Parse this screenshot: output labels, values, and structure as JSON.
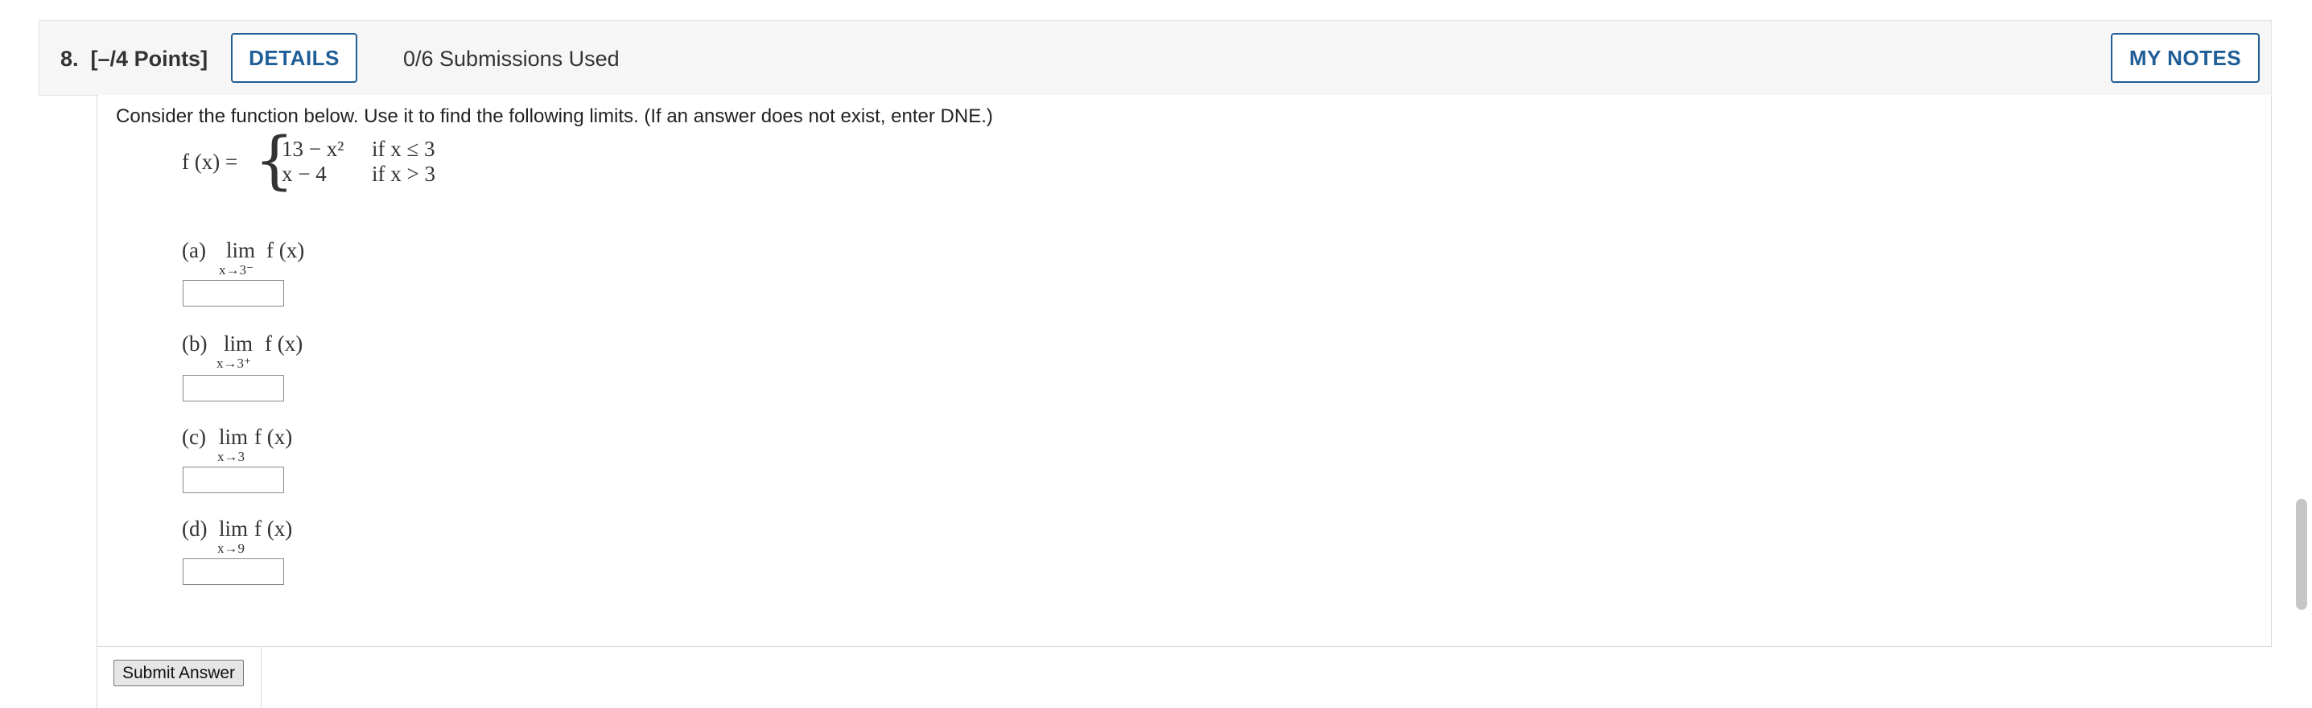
{
  "header": {
    "question_number": "8.",
    "points": "[–/4 Points]",
    "details_label": "DETAILS",
    "submissions": "0/6 Submissions Used",
    "notes_label": "MY NOTES"
  },
  "question": {
    "prompt": "Consider the function below. Use it to find the following limits. (If an answer does not exist, enter DNE.)",
    "function": {
      "lhs": "f (x) =",
      "case1_expr": "13 − x²",
      "case1_cond": "if x ≤ 3",
      "case2_expr": "x − 4",
      "case2_cond": "if x > 3"
    },
    "parts": [
      {
        "label": "(a)",
        "lim": "lim",
        "approach": "x→3⁻",
        "fn": "f (x)",
        "value": ""
      },
      {
        "label": "(b)",
        "lim": "lim",
        "approach": "x→3⁺",
        "fn": "f (x)",
        "value": ""
      },
      {
        "label": "(c)",
        "lim": "lim",
        "approach": "x→3",
        "fn": "f (x)",
        "value": ""
      },
      {
        "label": "(d)",
        "lim": "lim",
        "approach": "x→9",
        "fn": "f (x)",
        "value": ""
      }
    ]
  },
  "submit_label": "Submit Answer"
}
